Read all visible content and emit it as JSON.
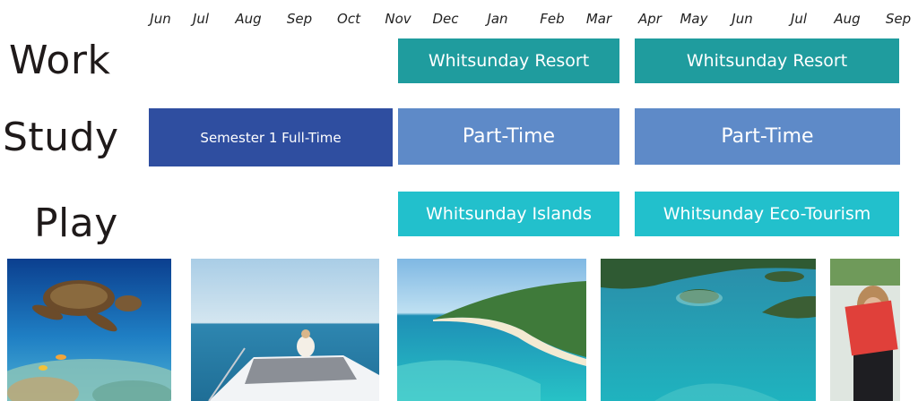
{
  "timeline": {
    "months": [
      "Jun",
      "Jul",
      "Aug",
      "Sep",
      "Oct",
      "Nov",
      "Dec",
      "Jan",
      "Feb",
      "Mar",
      "Apr",
      "May",
      "Jun",
      "Jul",
      "Aug",
      "Sep"
    ]
  },
  "rows": {
    "work": {
      "label": "Work",
      "bars": [
        "Whitsunday Resort",
        "Whitsunday Resort"
      ]
    },
    "study": {
      "label": "Study",
      "bars": [
        "Semester 1 Full-Time",
        "Part-Time",
        "Part-Time"
      ]
    },
    "play": {
      "label": "Play",
      "bars": [
        "Whitsunday Islands",
        "Whitsunday Eco-Tourism"
      ]
    }
  },
  "colors": {
    "work_bar": "#1f9c9e",
    "study_full_bar": "#2f4ea0",
    "study_part_bar": "#5e8ac8",
    "play_bar": "#22c0cc"
  },
  "photos": [
    {
      "subject": "sea turtle over coral reef"
    },
    {
      "subject": "woman relaxing on yacht bow"
    },
    {
      "subject": "aerial view of beach and turquoise water"
    },
    {
      "subject": "aerial view of islands and lagoon"
    },
    {
      "subject": "woman reading red book"
    }
  ]
}
